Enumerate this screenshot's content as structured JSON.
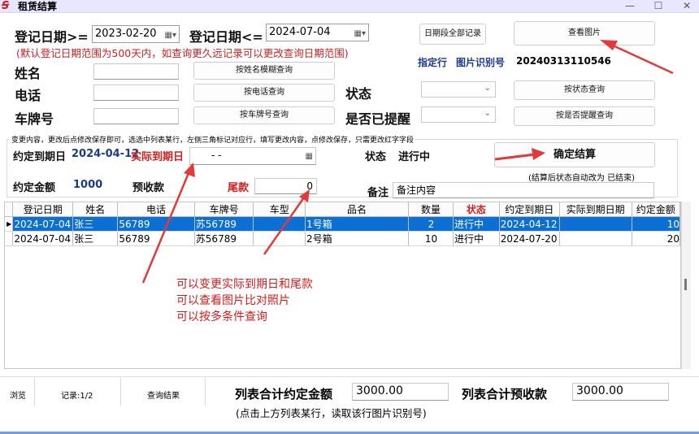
{
  "window": {
    "title": "租赁结算",
    "min": "—",
    "max": "☐",
    "close": "✕"
  },
  "filters": {
    "reg_from_label": "登记日期>=",
    "reg_from_value": "2023-02-20",
    "reg_to_label": "登记日期<=",
    "reg_to_value": "2024-07-04",
    "hint": "(默认登记日期范围为500天内，如查询更久远记录可以更改查询日期范围)",
    "name_label": "姓名",
    "phone_label": "电话",
    "plate_label": "车牌号",
    "status_label": "状态",
    "remind_label": "是否已提醒",
    "btn_all_dates": "日期段全部记录",
    "btn_view_image": "查看图片",
    "btn_name_query": "按姓名模糊查询",
    "btn_phone_query": "按电话查询",
    "btn_plate_query": "按车牌号查询",
    "btn_status_query": "按状态查询",
    "btn_remind_query": "按是否提醒查询",
    "locate_label": "指定行",
    "image_id_label": "图片识别号",
    "image_id_value": "20240313110546"
  },
  "edit": {
    "instructions": "变更内容，更改后点修改保存即可，选选中列表某行，左侧三角标记对应行，填写更改内容，点修改保存，只需更改红字字段",
    "due_label": "约定到期日",
    "due_value": "2024-04-12",
    "actual_label": "实际到期日",
    "actual_value": "  -  -",
    "status_label": "状态",
    "status_value": "进行中",
    "confirm_btn": "确定结算",
    "confirm_note": "(结算后状态自动改为 已结束)",
    "amount_label": "约定金额",
    "amount_value": "1000",
    "prepaid_label": "预收款",
    "balance_label": "尾款",
    "balance_value": "0",
    "remark_label": "备注",
    "remark_value": "备注内容"
  },
  "table": {
    "columns": [
      "登记日期",
      "姓名",
      "电话",
      "车牌号",
      "车型",
      "品名",
      "数量",
      "状态",
      "约定到期日",
      "实际到期日期",
      "约定金额"
    ],
    "rows": [
      [
        "2024-07-04",
        "张三",
        "56789",
        "苏56789",
        "",
        "1号箱",
        "2",
        "进行中",
        "2024-04-12",
        "",
        "10"
      ],
      [
        "2024-07-04",
        "张三",
        "56789",
        "苏56789",
        "",
        "2号箱",
        "10",
        "进行中",
        "2024-07-20",
        "",
        "20"
      ]
    ],
    "selected_row": 0,
    "row_indicator": "▶"
  },
  "annotation": {
    "line1": "可以变更实际到期日和尾款",
    "line2": "可以查看图片比对照片",
    "line3": "可以按多条件查询"
  },
  "footer": {
    "browse": "浏览",
    "records": "记录:1/2",
    "query_result": "查询结果",
    "sum_amount_label": "列表合计约定金额",
    "sum_amount_value": "3000.00",
    "sum_prepaid_label": "列表合计预收款",
    "sum_prepaid_value": "3000.00",
    "note": "(点击上方列表某行，读取该行图片识别号)"
  },
  "colors": {
    "accent_red": "#d22020",
    "selected_row": "#0c6fd4",
    "blue_text": "#1b3a8c"
  }
}
